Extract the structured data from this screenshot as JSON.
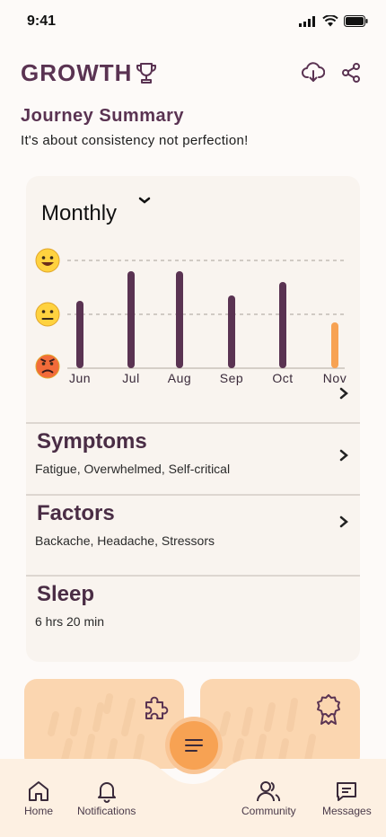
{
  "status": {
    "time": "9:41"
  },
  "header": {
    "title": "GROWTH",
    "icons": [
      "trophy-icon",
      "cloud-download-icon",
      "share-icon"
    ]
  },
  "summary": {
    "title": "Journey Summary",
    "subtitle": "It's about consistency not perfection!"
  },
  "mood_card": {
    "period": "Monthly",
    "mood_levels": [
      "happy",
      "neutral",
      "angry"
    ]
  },
  "chart_data": {
    "type": "bar",
    "categories": [
      "Jun",
      "Jul",
      "Aug",
      "Sep",
      "Oct",
      "Nov"
    ],
    "values": [
      1.25,
      1.8,
      1.8,
      1.35,
      1.6,
      0.85
    ],
    "ylim": [
      0,
      2
    ],
    "y_tick_labels": [
      "angry",
      "neutral",
      "happy"
    ],
    "highlight_color": "#f7a253",
    "bar_color": "#5a3352",
    "grid": "dashed at neutral and happy"
  },
  "sections": [
    {
      "title": "Symptoms",
      "detail": "Fatigue, Overwhelmed, Self-critical"
    },
    {
      "title": "Factors",
      "detail": "Backache, Headache, Stressors"
    },
    {
      "title": "Sleep",
      "detail": "6 hrs 20 min"
    }
  ],
  "tiles": [
    {
      "icon": "puzzle-icon"
    },
    {
      "icon": "badge-icon"
    }
  ],
  "nav": {
    "items": [
      {
        "label": "Home",
        "icon": "home-icon"
      },
      {
        "label": "Notifications",
        "icon": "bell-icon"
      },
      {
        "label": "Community",
        "icon": "community-icon"
      },
      {
        "label": "Messages",
        "icon": "messages-icon"
      }
    ],
    "fab_icon": "menu-icon"
  },
  "colors": {
    "brand": "#5a3352",
    "accent": "#f7a253",
    "card": "#f9f4ef",
    "tile": "#fbd6b0"
  }
}
